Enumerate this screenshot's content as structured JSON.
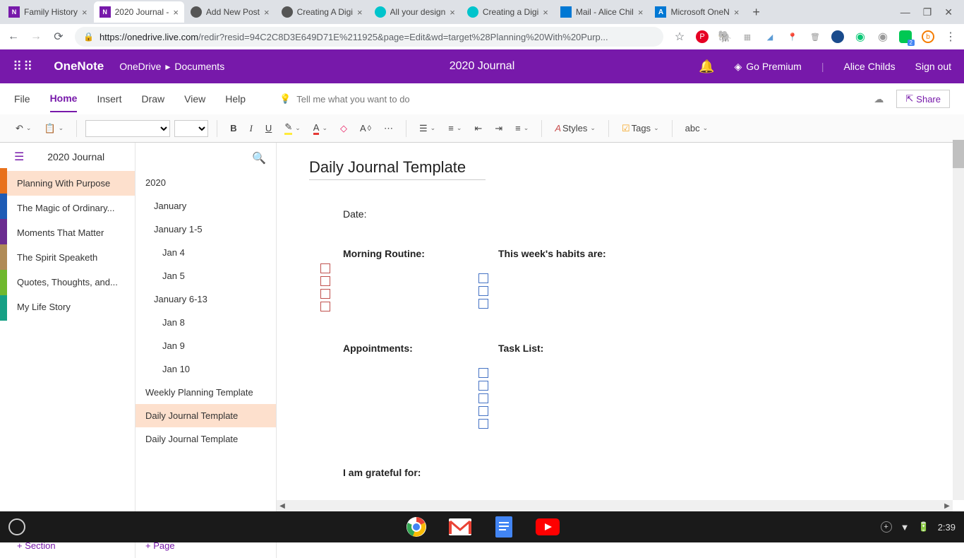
{
  "browser": {
    "tabs": [
      {
        "title": "Family History",
        "active": false
      },
      {
        "title": "2020 Journal - ",
        "active": true
      },
      {
        "title": "Add New Post",
        "active": false
      },
      {
        "title": "Creating A Digi",
        "active": false
      },
      {
        "title": "All your design",
        "active": false
      },
      {
        "title": "Creating a Digi",
        "active": false
      },
      {
        "title": "Mail - Alice Chil",
        "active": false
      },
      {
        "title": "Microsoft OneN",
        "active": false
      }
    ],
    "url_host": "https://onedrive.live.com",
    "url_path": "/redir?resid=94C2C8D3E649D71E%211925&page=Edit&wd=target%28Planning%20With%20Purp...",
    "ext_badge": "2"
  },
  "header": {
    "app": "OneNote",
    "breadcrumb1": "OneDrive",
    "breadcrumb2": "Documents",
    "title": "2020 Journal",
    "premium": "Go Premium",
    "user": "Alice Childs",
    "signout": "Sign out"
  },
  "ribbon_tabs": {
    "file": "File",
    "home": "Home",
    "insert": "Insert",
    "draw": "Draw",
    "view": "View",
    "help": "Help",
    "tellme": "Tell me what you want to do",
    "share": "Share"
  },
  "toolbar": {
    "styles": "Styles",
    "tags": "Tags",
    "spell": "abc"
  },
  "notebook": {
    "title": "2020 Journal",
    "sections": [
      "Planning With Purpose",
      "The Magic of Ordinary...",
      "Moments That Matter",
      "The Spirit Speaketh",
      "Quotes, Thoughts, and...",
      "My Life Story"
    ],
    "section_colors": [
      "#e8711c",
      "#1e5bb5",
      "#6b2d90",
      "#b08b57",
      "#6fb82e",
      "#16a085"
    ],
    "add_section": "+ Section",
    "pages": [
      {
        "title": "2020",
        "indent": 0
      },
      {
        "title": "January",
        "indent": 1
      },
      {
        "title": "January 1-5",
        "indent": 1
      },
      {
        "title": "Jan 4",
        "indent": 2
      },
      {
        "title": "Jan 5",
        "indent": 2
      },
      {
        "title": "January 6-13",
        "indent": 1
      },
      {
        "title": "Jan 8",
        "indent": 2
      },
      {
        "title": "Jan 9",
        "indent": 2
      },
      {
        "title": "Jan 10",
        "indent": 2
      },
      {
        "title": "Weekly Planning Template",
        "indent": 0
      },
      {
        "title": "Daily Journal Template",
        "indent": 0,
        "active": true
      },
      {
        "title": "Daily Journal Template",
        "indent": 0
      }
    ],
    "add_page": "+ Page"
  },
  "page": {
    "title": "Daily Journal Template",
    "date_label": "Date:",
    "morning": "Morning  Routine:",
    "habits": "This week's habits are:",
    "appointments": "Appointments:",
    "tasklist": "Task List:",
    "grateful": "I am grateful for:"
  },
  "taskbar": {
    "time": "2:39"
  }
}
